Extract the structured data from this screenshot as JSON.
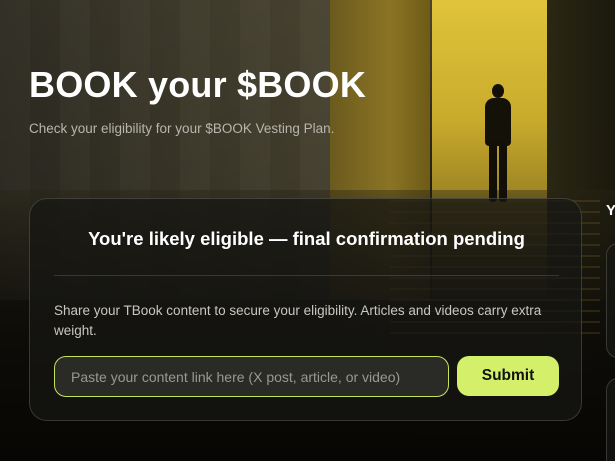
{
  "hero": {
    "title": "BOOK your $BOOK",
    "subtitle": "Check your eligibility for your $BOOK Vesting Plan."
  },
  "eligibility_card": {
    "heading": "You're likely eligible — final confirmation pending",
    "description": "Share your TBook content to secure your eligibility. Articles and videos carry extra weight.",
    "input_placeholder": "Paste your content link here (X post, article, or video)",
    "input_value": "",
    "submit_label": "Submit"
  },
  "side_panel": {
    "heading_peek": "Y"
  },
  "colors": {
    "accent": "#d4f06a",
    "input_border": "#c6e35e",
    "card_bg": "#161614",
    "subtitle_text": "#b8b6ad"
  }
}
